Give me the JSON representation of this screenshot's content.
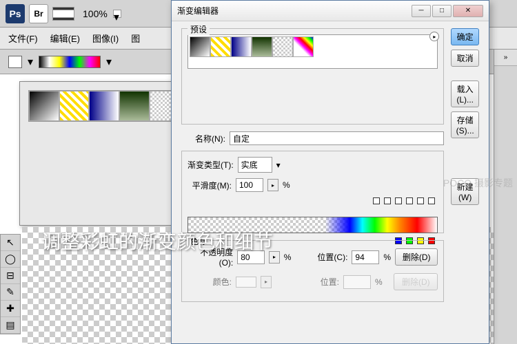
{
  "toolbar": {
    "ps": "Ps",
    "br": "Br",
    "zoom": "100%"
  },
  "menu": {
    "file": "文件(F)",
    "edit": "编辑(E)",
    "image": "图像(I)",
    "layer": "图"
  },
  "dialog": {
    "title": "渐变编辑器",
    "presets_label": "预设",
    "ok": "确定",
    "cancel": "取消",
    "load": "载入(L)...",
    "save": "存储(S)...",
    "name_label": "名称(N):",
    "name_value": "自定",
    "new_btn": "新建(W)",
    "type_label": "渐变类型(T):",
    "type_value": "实底",
    "smooth_label": "平滑度(M):",
    "smooth_value": "100",
    "pct": "%",
    "stops_label": "色标",
    "opacity_label": "不透明度(O):",
    "opacity_value": "80",
    "loc_label": "位置(C):",
    "loc_value": "94",
    "delete": "删除(D)",
    "color_label": "颜色:",
    "loc2_label": "位置:"
  },
  "overlay": "调整彩虹的渐变颜色和细节",
  "watermark": "POCO 摄影专题",
  "rightpanel": {
    "tab": "»"
  }
}
